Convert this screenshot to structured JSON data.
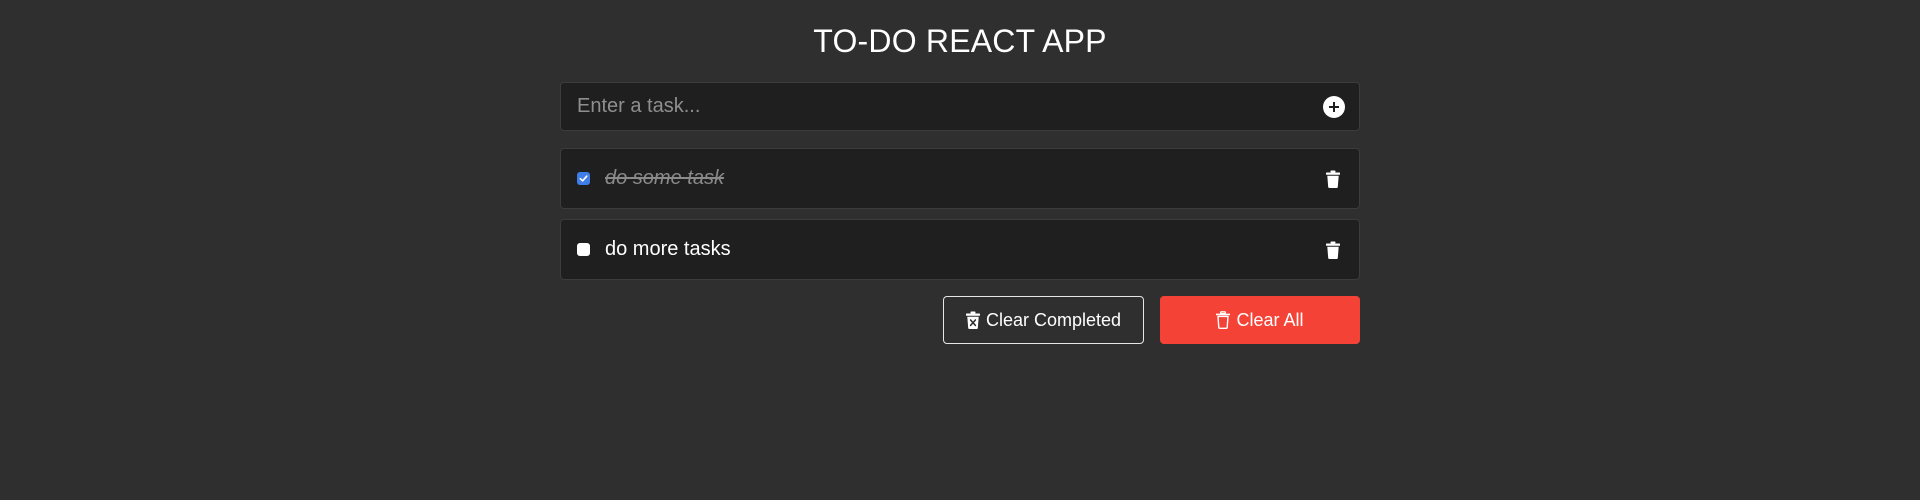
{
  "app": {
    "title": "TO-DO REACT APP"
  },
  "input": {
    "placeholder": "Enter a task...",
    "value": "",
    "add_icon": "plus-circle-icon"
  },
  "tasks": [
    {
      "text": "do some task",
      "completed": true
    },
    {
      "text": "do more tasks",
      "completed": false
    }
  ],
  "actions": {
    "clear_completed_label": "Clear Completed",
    "clear_completed_icon": "trash-x-icon",
    "clear_all_label": "Clear All",
    "clear_all_icon": "trash-outline-icon"
  },
  "colors": {
    "background": "#2f2f2f",
    "card": "#1f1f1f",
    "accent_checkbox": "#3f7ee8",
    "danger": "#f44336"
  }
}
